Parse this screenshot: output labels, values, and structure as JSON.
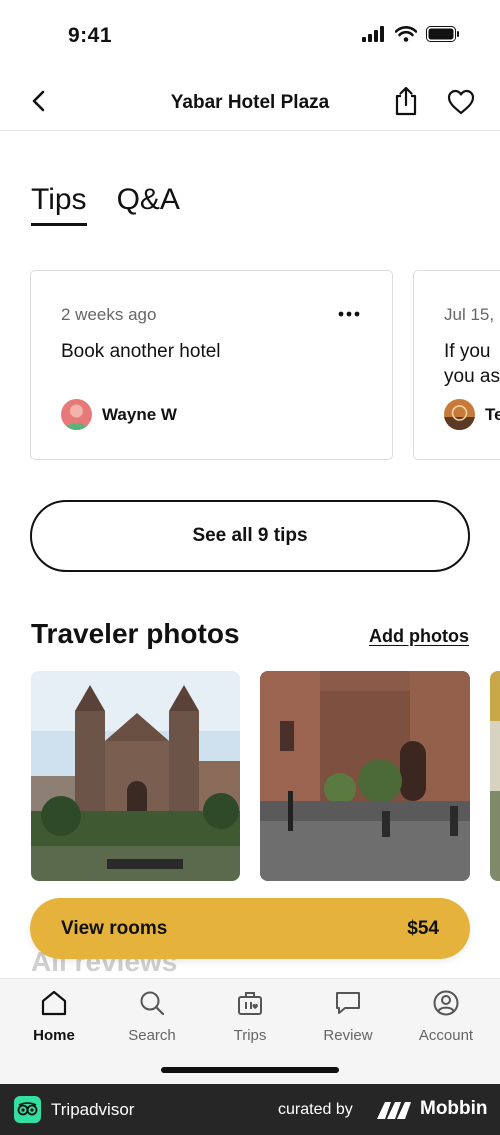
{
  "status_bar": {
    "time": "9:41"
  },
  "nav": {
    "title": "Yabar Hotel Plaza"
  },
  "tabs": [
    {
      "label": "Tips",
      "active": true
    },
    {
      "label": "Q&A",
      "active": false
    }
  ],
  "tips": [
    {
      "date": "2 weeks ago",
      "text": "Book another hotel",
      "author": "Wayne W"
    },
    {
      "date": "Jul 15,",
      "text": "If you\nyou as",
      "author": "Te"
    }
  ],
  "see_all_label": "See all 9 tips",
  "photos": {
    "heading": "Traveler photos",
    "add_label": "Add photos"
  },
  "reviews_heading": "All reviews",
  "cta": {
    "label": "View rooms",
    "price": "$54"
  },
  "tab_bar": {
    "items": [
      {
        "label": "Home",
        "icon": "home-icon",
        "active": true
      },
      {
        "label": "Search",
        "icon": "search-icon",
        "active": false
      },
      {
        "label": "Trips",
        "icon": "trips-icon",
        "active": false
      },
      {
        "label": "Review",
        "icon": "review-icon",
        "active": false
      },
      {
        "label": "Account",
        "icon": "account-icon",
        "active": false
      }
    ]
  },
  "footer": {
    "brand": "Tripadvisor",
    "curated_by": "curated by",
    "mobbin": "Mobbin"
  },
  "colors": {
    "accent": "#e5b33b",
    "footer_bg": "#262626",
    "tripadvisor_green": "#34e0a1"
  }
}
